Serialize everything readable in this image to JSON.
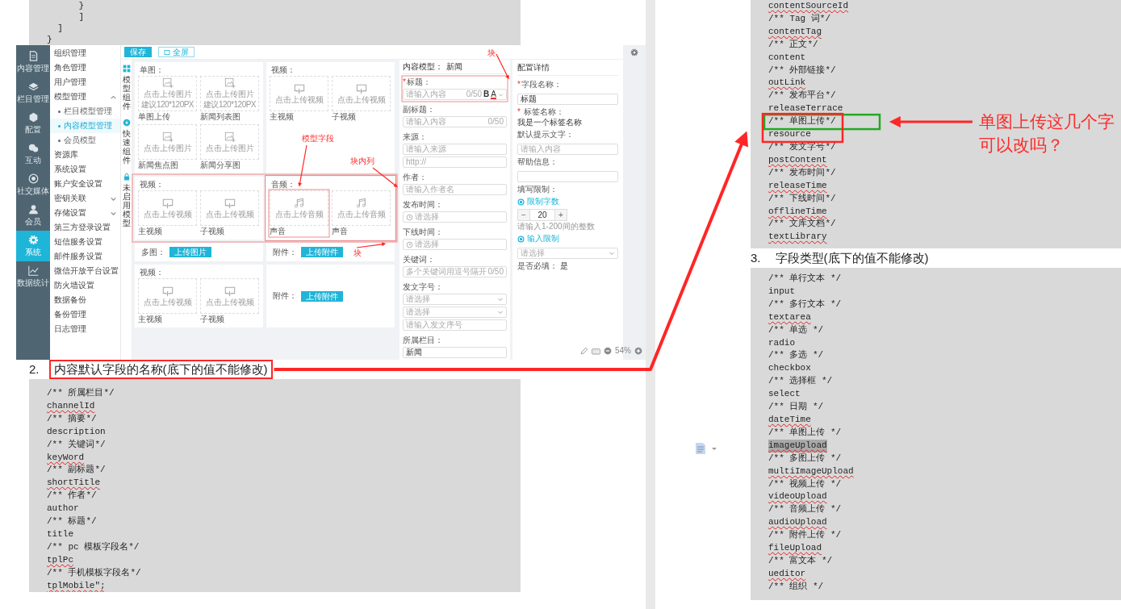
{
  "top_code": [
    {
      "text": "      }",
      "misspelled": false
    },
    {
      "text": "      ]",
      "misspelled": false
    },
    {
      "text": "  ]",
      "misspelled": false
    },
    {
      "text": "}",
      "misspelled": false
    }
  ],
  "screenshot": {
    "nav": [
      {
        "label": "内容管理",
        "selected": false
      },
      {
        "label": "栏目管理",
        "selected": false
      },
      {
        "label": "配置",
        "selected": false
      },
      {
        "label": "互动",
        "selected": false
      },
      {
        "label": "社交媒体",
        "selected": false
      },
      {
        "label": "会员",
        "selected": false
      },
      {
        "label": "系统",
        "selected": true
      },
      {
        "label": "数据统计",
        "selected": false
      }
    ],
    "menu": [
      {
        "label": "组织管理",
        "selected": false
      },
      {
        "label": "角色管理",
        "selected": false
      },
      {
        "label": "用户管理",
        "selected": false
      },
      {
        "label": "模型管理",
        "selected": false,
        "expanded": true,
        "children": [
          {
            "label": "栏目模型管理",
            "selected": false
          },
          {
            "label": "内容模型管理",
            "selected": true
          },
          {
            "label": "会员模型",
            "selected": false
          }
        ]
      },
      {
        "label": "资源库",
        "selected": false
      },
      {
        "label": "系统设置",
        "selected": false
      },
      {
        "label": "账户安全设置",
        "selected": false
      },
      {
        "label": "密钥关联",
        "selected": false,
        "expanded": false
      },
      {
        "label": "存储设置",
        "selected": false,
        "expanded": false
      },
      {
        "label": "第三方登录设置",
        "selected": false
      },
      {
        "label": "短信服务设置",
        "selected": false
      },
      {
        "label": "邮件服务设置",
        "selected": false
      },
      {
        "label": "微信开放平台设置",
        "selected": false
      },
      {
        "label": "防火墙设置",
        "selected": false
      },
      {
        "label": "数据备份",
        "selected": false
      },
      {
        "label": "备份管理",
        "selected": false
      },
      {
        "label": "日志管理",
        "selected": false
      }
    ],
    "save_button": "保存",
    "fullscreen_button": "全屏",
    "side_tabs": [
      {
        "label": "模型组件"
      },
      {
        "label": "快速组件"
      },
      {
        "label": "未启用模型"
      }
    ],
    "block_rows": [
      {
        "highlighted": false,
        "cards": [
          {
            "label": "单图：",
            "kind": "tiles",
            "highlighted": false,
            "tiles": [
              {
                "kind": "image",
                "hint": "点击上传图片",
                "note": "建议120*120PX",
                "caption": "单图上传",
                "highlighted": false
              },
              {
                "kind": "image",
                "hint": "点击上传图片",
                "note": "建议120*120PX",
                "caption": "新闻列表图",
                "highlighted": false
              },
              {
                "kind": "image",
                "hint": "点击上传图片",
                "caption": "新闻焦点图",
                "highlighted": false
              },
              {
                "kind": "image",
                "hint": "点击上传图片",
                "caption": "新闻分享图",
                "highlighted": false
              }
            ]
          },
          {
            "label": "视频：",
            "kind": "tiles",
            "highlighted": false,
            "tiles": [
              {
                "kind": "video",
                "hint": "点击上传视频",
                "caption": "主视频",
                "highlighted": false
              },
              {
                "kind": "video",
                "hint": "点击上传视频",
                "caption": "子视频",
                "highlighted": false
              }
            ]
          }
        ]
      },
      {
        "highlighted": true,
        "cards": [
          {
            "label": "视频：",
            "kind": "tiles",
            "highlighted": false,
            "tiles": [
              {
                "kind": "video",
                "hint": "点击上传视频",
                "caption": "主视频",
                "highlighted": false
              },
              {
                "kind": "video",
                "hint": "点击上传视频",
                "caption": "子视频",
                "highlighted": false
              }
            ]
          },
          {
            "label": "音频：",
            "kind": "tiles",
            "highlighted": true,
            "tiles": [
              {
                "kind": "audio",
                "hint": "点击上传音频",
                "caption": "声音",
                "highlighted": true
              },
              {
                "kind": "audio",
                "hint": "点击上传音频",
                "caption": "声音",
                "highlighted": false
              }
            ]
          }
        ]
      },
      {
        "highlighted": false,
        "cards": [
          {
            "label": "多图：",
            "kind": "button",
            "highlighted": false,
            "button": "上传图片"
          },
          {
            "label": "附件：",
            "kind": "button",
            "highlighted": false,
            "button": "上传附件"
          }
        ]
      },
      {
        "highlighted": false,
        "cards": [
          {
            "label": "视频：",
            "kind": "tiles",
            "highlighted": false,
            "tiles": [
              {
                "kind": "video",
                "hint": "点击上传视频",
                "caption": "主视频",
                "highlighted": false
              },
              {
                "kind": "video",
                "hint": "点击上传视频",
                "caption": "子视频",
                "highlighted": false
              }
            ]
          },
          {
            "label": "附件：",
            "kind": "button",
            "highlighted": false,
            "button": "上传附件"
          }
        ]
      }
    ],
    "form": {
      "model_label": "内容模型：",
      "model_name": "新闻",
      "fields": [
        {
          "mark": "*",
          "label": "标题：",
          "highlighted": true,
          "inputs": [
            {
              "kind": "text",
              "placeholder": "请输入内容",
              "counter": "0/50",
              "bold_glyph": "B",
              "color_glyph": "A"
            }
          ]
        },
        {
          "label": "副标题：",
          "highlighted": false,
          "inputs": [
            {
              "kind": "text",
              "placeholder": "请输入内容",
              "counter": "0/50"
            }
          ]
        },
        {
          "label": "来源：",
          "highlighted": false,
          "inputs": [
            {
              "kind": "text",
              "placeholder": "请输入来源"
            },
            {
              "kind": "text",
              "placeholder": "http://"
            }
          ]
        },
        {
          "label": "作者：",
          "highlighted": false,
          "inputs": [
            {
              "kind": "text",
              "placeholder": "请输入作者名"
            }
          ]
        },
        {
          "label": "发布时间：",
          "highlighted": false,
          "inputs": [
            {
              "kind": "date",
              "placeholder": "请选择"
            }
          ]
        },
        {
          "label": "下线时间：",
          "highlighted": false,
          "inputs": [
            {
              "kind": "date",
              "placeholder": "请选择"
            }
          ]
        },
        {
          "label": "关键词：",
          "highlighted": false,
          "inputs": [
            {
              "kind": "text",
              "placeholder": "多个关键词用逗号隔开",
              "counter": "0/50"
            }
          ]
        },
        {
          "label": "发文字号：",
          "highlighted": false,
          "inputs": [
            {
              "kind": "select",
              "placeholder": "请选择"
            },
            {
              "kind": "select",
              "placeholder": "请选择"
            },
            {
              "kind": "text",
              "placeholder": "请输入发文序号"
            }
          ]
        },
        {
          "label": "所属栏目：",
          "highlighted": false,
          "inputs": [
            {
              "kind": "text",
              "value": "新闻"
            }
          ]
        }
      ]
    },
    "config": {
      "title": "配置详情",
      "field_name_mark": "*",
      "field_name_label": "字段名称：",
      "field_name_value": "标题",
      "tag_mark": "*",
      "tag_label": "标签名称：",
      "tag_value": "我是一个标签名称",
      "hint_label": "默认提示文字：",
      "hint_placeholder": "请输入内容",
      "help_label": "帮助信息：",
      "limit_label": "填写限制：",
      "options": [
        {
          "label": "限制字数",
          "checked": true
        },
        {
          "label": "输入限制",
          "checked": true
        }
      ],
      "minus": "−",
      "count": "20",
      "plus": "+",
      "count_hint": "请输入1-200间的整数",
      "rule_placeholder": "请选择",
      "required_label": "是否必填：",
      "required_value": "是"
    },
    "zoom_level": "54%",
    "notes": [
      "模型字段",
      "块内列",
      "块",
      "块"
    ]
  },
  "heading_2": {
    "number": "2.",
    "text": "内容默认字段的名称(底下的值不能修改)",
    "boxed": true
  },
  "code_2": [
    {
      "text": "/** 所属栏目*/",
      "misspelled": false
    },
    {
      "text": "channelId",
      "misspelled": true
    },
    {
      "text": "/** 摘要*/",
      "misspelled": false
    },
    {
      "text": "description",
      "misspelled": false
    },
    {
      "text": "/** 关键词*/",
      "misspelled": false
    },
    {
      "text": "keyWord",
      "misspelled": true
    },
    {
      "text": "/** 副标题*/",
      "misspelled": false
    },
    {
      "text": "shortTitle",
      "misspelled": true
    },
    {
      "text": "/** 作者*/",
      "misspelled": false
    },
    {
      "text": "author",
      "misspelled": false
    },
    {
      "text": "/** 标题*/",
      "misspelled": false
    },
    {
      "text": "title",
      "misspelled": false
    },
    {
      "text": "/** pc 模板字段名*/",
      "misspelled": false
    },
    {
      "text": "tplPc",
      "misspelled": true
    },
    {
      "text": "/** 手机模板字段名*/",
      "misspelled": false
    },
    {
      "text": "tplMobile\";",
      "misspelled": true
    }
  ],
  "right_code": [
    {
      "kind": "line",
      "text": "contentSourceId",
      "misspelled": true
    },
    {
      "kind": "line",
      "text": "/** Tag 词*/",
      "misspelled": false
    },
    {
      "kind": "line",
      "text": "contentTag",
      "misspelled": true
    },
    {
      "kind": "line",
      "text": "/** 正文*/",
      "misspelled": false
    },
    {
      "kind": "line",
      "text": "content",
      "misspelled": false
    },
    {
      "kind": "line",
      "text": "/** 外部链接*/",
      "misspelled": false
    },
    {
      "kind": "line",
      "text": "outLink",
      "misspelled": true
    },
    {
      "kind": "line",
      "text": "/** 发布平台*/",
      "misspelled": false
    },
    {
      "kind": "line",
      "text": "releaseTerrace",
      "misspelled": true
    },
    {
      "kind": "boxed",
      "lines": [
        {
          "text": "/** 单图上传*/",
          "misspelled": false
        },
        {
          "text": "resource",
          "misspelled": false
        }
      ]
    },
    {
      "kind": "line",
      "text": "/** 发文字号*/",
      "misspelled": false
    },
    {
      "kind": "line",
      "text": "postContent",
      "misspelled": true
    },
    {
      "kind": "line",
      "text": "/** 发布时间*/",
      "misspelled": false
    },
    {
      "kind": "line",
      "text": "releaseTime",
      "misspelled": true
    },
    {
      "kind": "line",
      "text": "/** 下线时间*/",
      "misspelled": false
    },
    {
      "kind": "line",
      "text": "offlineTime",
      "misspelled": true
    },
    {
      "kind": "line",
      "text": "/** 文库文档*/",
      "misspelled": false
    },
    {
      "kind": "line",
      "text": "textLibrary",
      "misspelled": true
    }
  ],
  "note": "单图上传这几个字可以改吗？",
  "heading_3": {
    "number": "3.",
    "text": "字段类型(底下的值不能修改)",
    "boxed": false
  },
  "code_3": [
    {
      "text": "/** 单行文本 */",
      "misspelled": false,
      "highlighted": false
    },
    {
      "text": "input",
      "misspelled": false,
      "highlighted": false
    },
    {
      "text": "/** 多行文本 */",
      "misspelled": false,
      "highlighted": false
    },
    {
      "text": "textarea",
      "misspelled": true,
      "highlighted": false
    },
    {
      "text": "/** 单选 */",
      "misspelled": false,
      "highlighted": false
    },
    {
      "text": "radio",
      "misspelled": false,
      "highlighted": false
    },
    {
      "text": "/** 多选 */",
      "misspelled": false,
      "highlighted": false
    },
    {
      "text": "checkbox",
      "misspelled": false,
      "highlighted": false
    },
    {
      "text": "/** 选择框 */",
      "misspelled": false,
      "highlighted": false
    },
    {
      "text": "select",
      "misspelled": false,
      "highlighted": false
    },
    {
      "text": "/** 日期 */",
      "misspelled": false,
      "highlighted": false
    },
    {
      "text": "dateTime",
      "misspelled": true,
      "highlighted": false
    },
    {
      "text": "/** 单图上传 */",
      "misspelled": false,
      "highlighted": false
    },
    {
      "text": "imageUpload",
      "misspelled": true,
      "highlighted": true
    },
    {
      "text": "/** 多图上传 */",
      "misspelled": false,
      "highlighted": false
    },
    {
      "text": "multiImageUpload",
      "misspelled": true,
      "highlighted": false
    },
    {
      "text": "/** 视频上传 */",
      "misspelled": false,
      "highlighted": false
    },
    {
      "text": "videoUpload",
      "misspelled": true,
      "highlighted": false
    },
    {
      "text": "/** 音频上传 */",
      "misspelled": false,
      "highlighted": false
    },
    {
      "text": "audioUpload",
      "misspelled": true,
      "highlighted": false
    },
    {
      "text": "/** 附件上传 */",
      "misspelled": false,
      "highlighted": false
    },
    {
      "text": "fileUpload",
      "misspelled": true,
      "highlighted": false
    },
    {
      "text": "/** 富文本 */",
      "misspelled": false,
      "highlighted": false
    },
    {
      "text": "ueditor",
      "misspelled": true,
      "highlighted": false
    },
    {
      "text": "/** 组织 */",
      "misspelled": false,
      "highlighted": false
    }
  ]
}
